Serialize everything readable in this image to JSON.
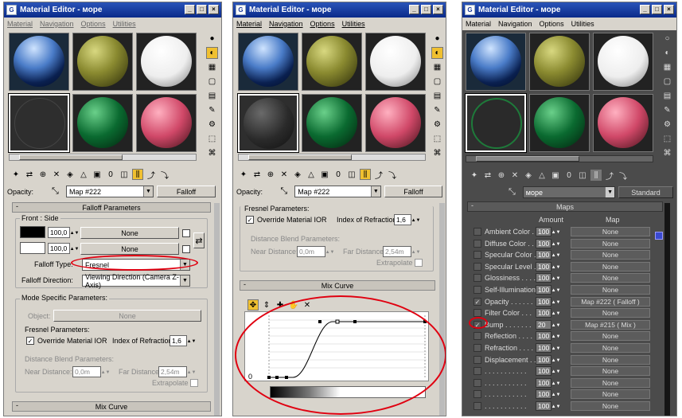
{
  "panel1": {
    "title": "Material Editor - море",
    "menu": [
      "Material",
      "Navigation",
      "Options",
      "Utilities"
    ],
    "opacity_label": "Opacity:",
    "map_name": "Map #222",
    "map_type": "Falloff",
    "falloff_section": "Falloff Parameters",
    "front_side": "Front : Side",
    "color1_amount": "100,0",
    "color2_amount": "100,0",
    "none": "None",
    "falloff_type_label": "Falloff Type:",
    "falloff_type": "Fresnel",
    "falloff_dir_label": "Falloff Direction:",
    "falloff_dir": "Viewing Direction (Camera Z-Axis)",
    "mode_section": "Mode Specific Parameters:",
    "object_label": "Object:",
    "object_value": "None",
    "fresnel_label": "Fresnel Parameters:",
    "override_ior": "Override Material IOR",
    "ior_label": "Index of Refraction",
    "ior_value": "1,6",
    "distance_blend": "Distance Blend Parameters:",
    "near_label": "Near Distance:",
    "near_value": "0,0m",
    "far_label": "Far Distance:",
    "far_value": "2,54m",
    "extrapolate": "Extrapolate",
    "mix_curve": "Mix Curve"
  },
  "panel2": {
    "title": "Material Editor - море",
    "menu": [
      "Material",
      "Navigation",
      "Options",
      "Utilities"
    ],
    "opacity_label": "Opacity:",
    "map_name": "Map #222",
    "map_type": "Falloff",
    "fresnel_label": "Fresnel Parameters:",
    "override_ior": "Override Material IOR",
    "ior_label": "Index of Refraction",
    "ior_value": "1,6",
    "distance_blend": "Distance Blend Parameters:",
    "near_label": "Near Distance:",
    "near_value": "0,0m",
    "far_label": "Far Distance:",
    "far_value": "2,54m",
    "extrapolate": "Extrapolate",
    "mix_curve": "Mix Curve",
    "curve_zero": "0"
  },
  "panel3": {
    "title": "Material Editor - море",
    "menu": [
      "Material",
      "Navigation",
      "Options",
      "Utilities"
    ],
    "material_name": "море",
    "material_type": "Standard",
    "maps_section": "Maps",
    "col_amount": "Amount",
    "col_map": "Map",
    "maps": [
      {
        "name": "Ambient Color . .",
        "amount": "100",
        "map": "None",
        "checked": false
      },
      {
        "name": "Diffuse Color . .",
        "amount": "100",
        "map": "None",
        "checked": false
      },
      {
        "name": "Specular Color . .",
        "amount": "100",
        "map": "None",
        "checked": false
      },
      {
        "name": "Specular Level .",
        "amount": "100",
        "map": "None",
        "checked": false
      },
      {
        "name": "Glossiness . . . .",
        "amount": "100",
        "map": "None",
        "checked": false
      },
      {
        "name": "Self-Illumination .",
        "amount": "100",
        "map": "None",
        "checked": false
      },
      {
        "name": "Opacity . . . . . .",
        "amount": "100",
        "map": "Map #222  ( Falloff )",
        "checked": true
      },
      {
        "name": "Filter Color . . .",
        "amount": "100",
        "map": "None",
        "checked": false
      },
      {
        "name": "Bump . . . . . . .",
        "amount": "20",
        "map": "Map #215  ( Mix )",
        "checked": true
      },
      {
        "name": "Reflection . . . .",
        "amount": "100",
        "map": "None",
        "checked": false
      },
      {
        "name": "Refraction . . . .",
        "amount": "100",
        "map": "None",
        "checked": false
      },
      {
        "name": "Displacement . . .",
        "amount": "100",
        "map": "None",
        "checked": false
      },
      {
        "name": ". . . . . . . . . . .",
        "amount": "100",
        "map": "None",
        "checked": false
      },
      {
        "name": ". . . . . . . . . . .",
        "amount": "100",
        "map": "None",
        "checked": false
      },
      {
        "name": ". . . . . . . . . . .",
        "amount": "100",
        "map": "None",
        "checked": false
      },
      {
        "name": ". . . . . . . . . . .",
        "amount": "100",
        "map": "None",
        "checked": false
      }
    ]
  },
  "colors": {
    "panel_bg": "#d8d4cc",
    "dark_bg": "#4b4b4b",
    "highlight": "#e00010"
  }
}
